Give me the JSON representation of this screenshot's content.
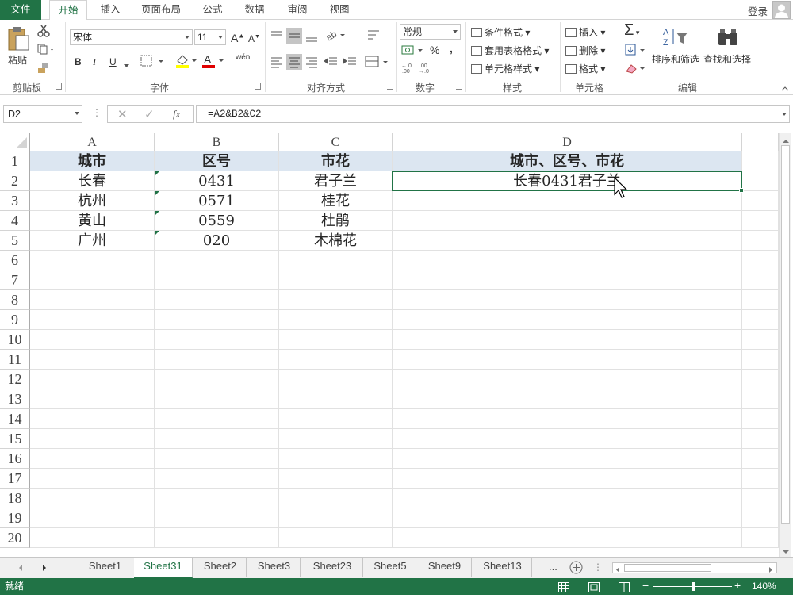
{
  "ribbon_tabs": {
    "file": "文件",
    "tabs": [
      "开始",
      "插入",
      "页面布局",
      "公式",
      "数据",
      "审阅",
      "视图"
    ],
    "active": "开始"
  },
  "account": {
    "login": "登录"
  },
  "clipboard": {
    "paste": "粘贴",
    "group": "剪贴板"
  },
  "font": {
    "name": "宋体",
    "size": "11",
    "bold": "B",
    "italic": "I",
    "underline": "U",
    "wen": "wén",
    "group": "字体"
  },
  "align": {
    "group": "对齐方式"
  },
  "number": {
    "format": "常规",
    "percent": "%",
    "comma": ",",
    "group": "数字"
  },
  "styles": {
    "cond": "条件格式",
    "table": "套用表格格式",
    "cell": "单元格样式",
    "group": "样式"
  },
  "cells": {
    "insert": "插入",
    "delete": "删除",
    "format": "格式",
    "group": "单元格"
  },
  "editing": {
    "sigma": "Σ",
    "sort": "排序和筛选",
    "find": "查找和选择",
    "group": "编辑"
  },
  "formula_bar": {
    "name_box": "D2",
    "fx": "fx",
    "formula": "=A2&B2&C2"
  },
  "grid": {
    "columns": [
      "A",
      "B",
      "C",
      "D"
    ],
    "rows": [
      "1",
      "2",
      "3",
      "4",
      "5",
      "6",
      "7",
      "8",
      "9",
      "10",
      "11",
      "12",
      "13",
      "14",
      "15",
      "16",
      "17",
      "18",
      "19",
      "20"
    ],
    "header": [
      "城市",
      "区号",
      "市花",
      "城市、区号、市花"
    ],
    "data": [
      [
        "长春",
        "0431",
        "君子兰",
        "长春0431君子兰"
      ],
      [
        "杭州",
        "0571",
        "桂花",
        ""
      ],
      [
        "黄山",
        "0559",
        "杜鹃",
        ""
      ],
      [
        "广州",
        "020",
        "木棉花",
        ""
      ]
    ]
  },
  "sheets": [
    "Sheet1",
    "Sheet31",
    "Sheet2",
    "Sheet3",
    "Sheet23",
    "Sheet5",
    "Sheet9",
    "Sheet13"
  ],
  "active_sheet": "Sheet31",
  "sheet_more": "...",
  "status": {
    "ready": "就绪",
    "zoom": "140%"
  },
  "colors": {
    "accent": "#217346",
    "header_fill": "#dce6f1"
  }
}
